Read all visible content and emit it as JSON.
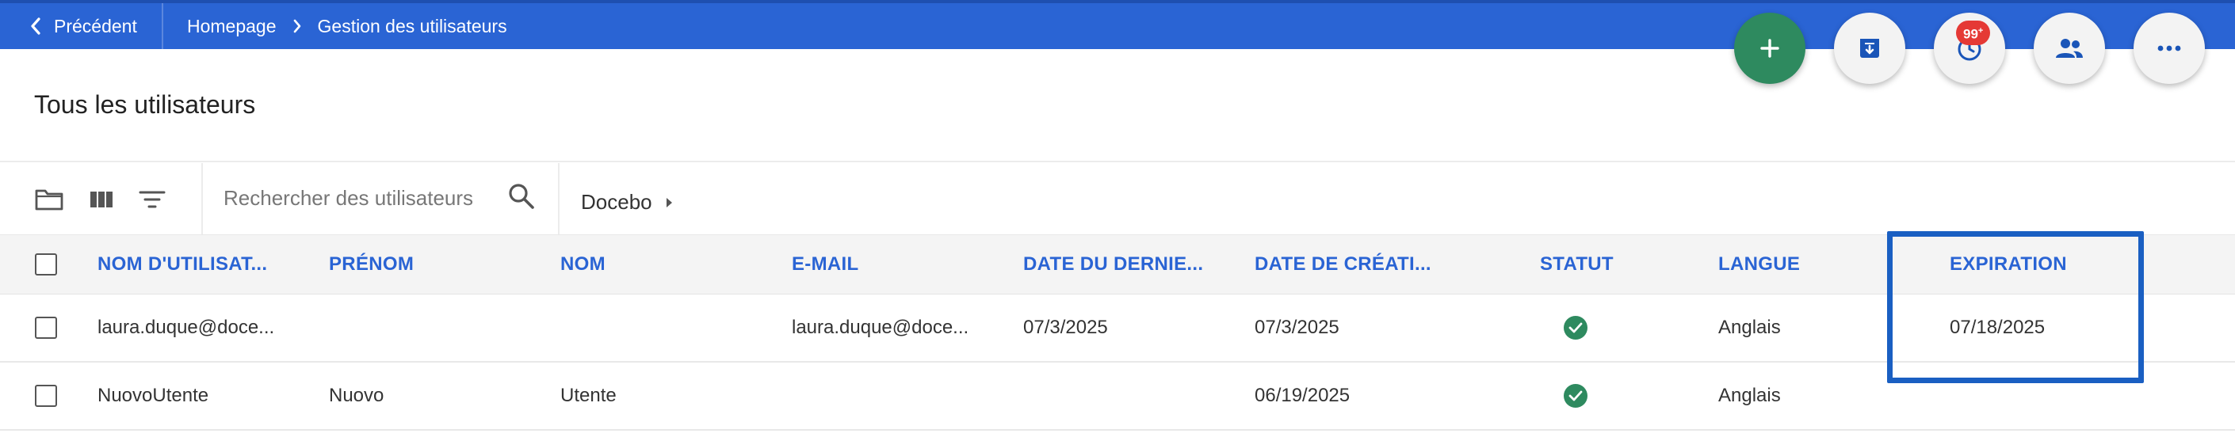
{
  "header": {
    "back_label": "Précédent",
    "breadcrumb": [
      "Homepage",
      "Gestion des utilisateurs"
    ]
  },
  "actions": {
    "add_icon": "plus-icon",
    "archive_icon": "archive-download-icon",
    "history_icon": "clock-icon",
    "history_badge": "99",
    "history_badge_plus": "+",
    "groups_icon": "users-icon",
    "more_icon": "more-horizontal-icon"
  },
  "page": {
    "title": "Tous les utilisateurs"
  },
  "toolbar": {
    "folder_icon": "folder-icon",
    "columns_icon": "columns-icon",
    "filter_icon": "filter-icon",
    "search_placeholder": "Rechercher des utilisateurs",
    "branch_label": "Docebo"
  },
  "table": {
    "columns": [
      "NOM D'UTILISAT...",
      "PRÉNOM",
      "NOM",
      "E-MAIL",
      "DATE DU DERNIE...",
      "DATE DE CRÉATI...",
      "STATUT",
      "LANGUE",
      "EXPIRATION"
    ],
    "rows": [
      {
        "username": "laura.duque@doce...",
        "first_name": "",
        "last_name": "",
        "email": "laura.duque@doce...",
        "last_login": "07/3/2025",
        "created": "07/3/2025",
        "status": "active",
        "language": "Anglais",
        "expiration": "07/18/2025"
      },
      {
        "username": "NuovoUtente",
        "first_name": "Nuovo",
        "last_name": "Utente",
        "email": "",
        "last_login": "",
        "created": "06/19/2025",
        "status": "active",
        "language": "Anglais",
        "expiration": ""
      }
    ]
  },
  "colors": {
    "brand_blue": "#2a64d4",
    "accent_green": "#2e8a5f",
    "badge_red": "#e53935",
    "highlight_border": "#1a5fc2"
  }
}
